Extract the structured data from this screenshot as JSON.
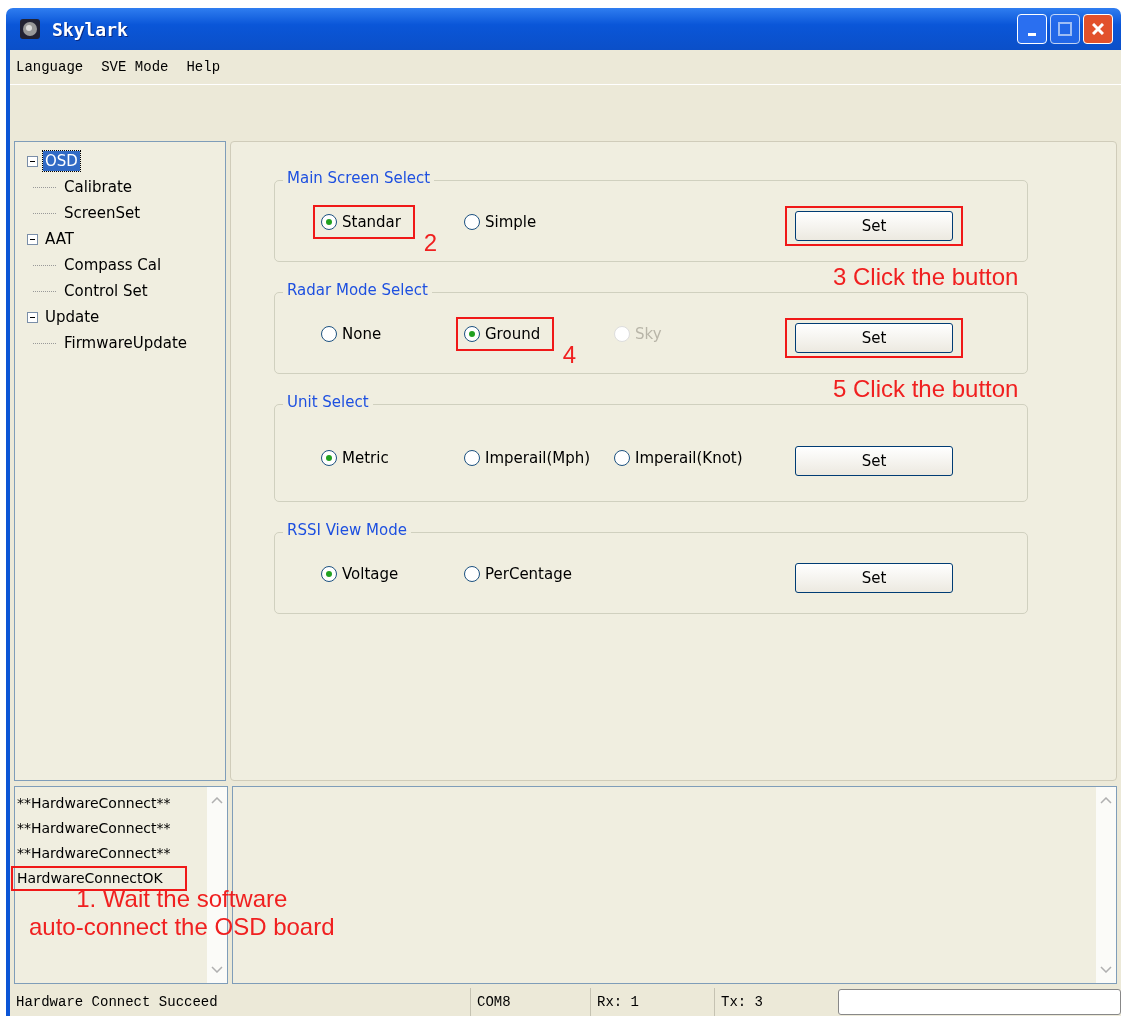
{
  "window": {
    "title": "Skylark"
  },
  "menu": [
    "Language",
    "SVE Mode",
    "Help"
  ],
  "tree": [
    {
      "label": "OSD",
      "selected": true,
      "expanded": true,
      "children": [
        {
          "label": "Calibrate",
          "selected": false
        },
        {
          "label": "ScreenSet",
          "selected": false
        }
      ]
    },
    {
      "label": "AAT",
      "selected": false,
      "expanded": true,
      "children": [
        {
          "label": "Compass Cal",
          "selected": false
        },
        {
          "label": "Control Set",
          "selected": false
        }
      ]
    },
    {
      "label": "Update",
      "selected": false,
      "expanded": true,
      "children": [
        {
          "label": "FirmwareUpdate",
          "selected": false
        }
      ]
    }
  ],
  "groups": [
    {
      "title": "Main Screen Select",
      "options": [
        {
          "label": "Standar",
          "selected": true,
          "disabled": false,
          "highlighted": true
        },
        {
          "label": "Simple",
          "selected": false,
          "disabled": false,
          "highlighted": false
        }
      ],
      "option_note": "2",
      "button": {
        "label": "Set",
        "highlighted": true
      },
      "button_note": "3 Click the button"
    },
    {
      "title": "Radar Mode Select",
      "options": [
        {
          "label": "None",
          "selected": false,
          "disabled": false,
          "highlighted": false
        },
        {
          "label": "Ground",
          "selected": true,
          "disabled": false,
          "highlighted": true
        },
        {
          "label": "Sky",
          "selected": false,
          "disabled": true,
          "highlighted": false
        }
      ],
      "option_note": "4",
      "button": {
        "label": "Set",
        "highlighted": true
      },
      "button_note": "5 Click the button"
    },
    {
      "title": "Unit Select",
      "options": [
        {
          "label": "Metric",
          "selected": true,
          "disabled": false,
          "highlighted": false
        },
        {
          "label": "Imperail(Mph)",
          "selected": false,
          "disabled": false,
          "highlighted": false
        },
        {
          "label": "Imperail(Knot)",
          "selected": false,
          "disabled": false,
          "highlighted": false
        }
      ],
      "button": {
        "label": "Set"
      }
    },
    {
      "title": "RSSI View Mode",
      "options": [
        {
          "label": "Voltage",
          "selected": true,
          "disabled": false,
          "highlighted": false
        },
        {
          "label": "PerCentage",
          "selected": false,
          "disabled": false,
          "highlighted": false
        }
      ],
      "button": {
        "label": "Set"
      }
    }
  ],
  "log": {
    "lines": [
      {
        "text": "**HardwareConnect**",
        "highlighted": false
      },
      {
        "text": "**HardwareConnect**",
        "highlighted": false
      },
      {
        "text": "**HardwareConnect**",
        "highlighted": false
      },
      {
        "text": "HardwareConnectOK",
        "highlighted": true
      }
    ],
    "note_lines": [
      "1. Wait the software",
      "auto-connect the OSD board"
    ]
  },
  "status_bar": [
    "Hardware Connect Succeed",
    "COM8",
    "Rx: 1",
    "Tx: 3"
  ]
}
